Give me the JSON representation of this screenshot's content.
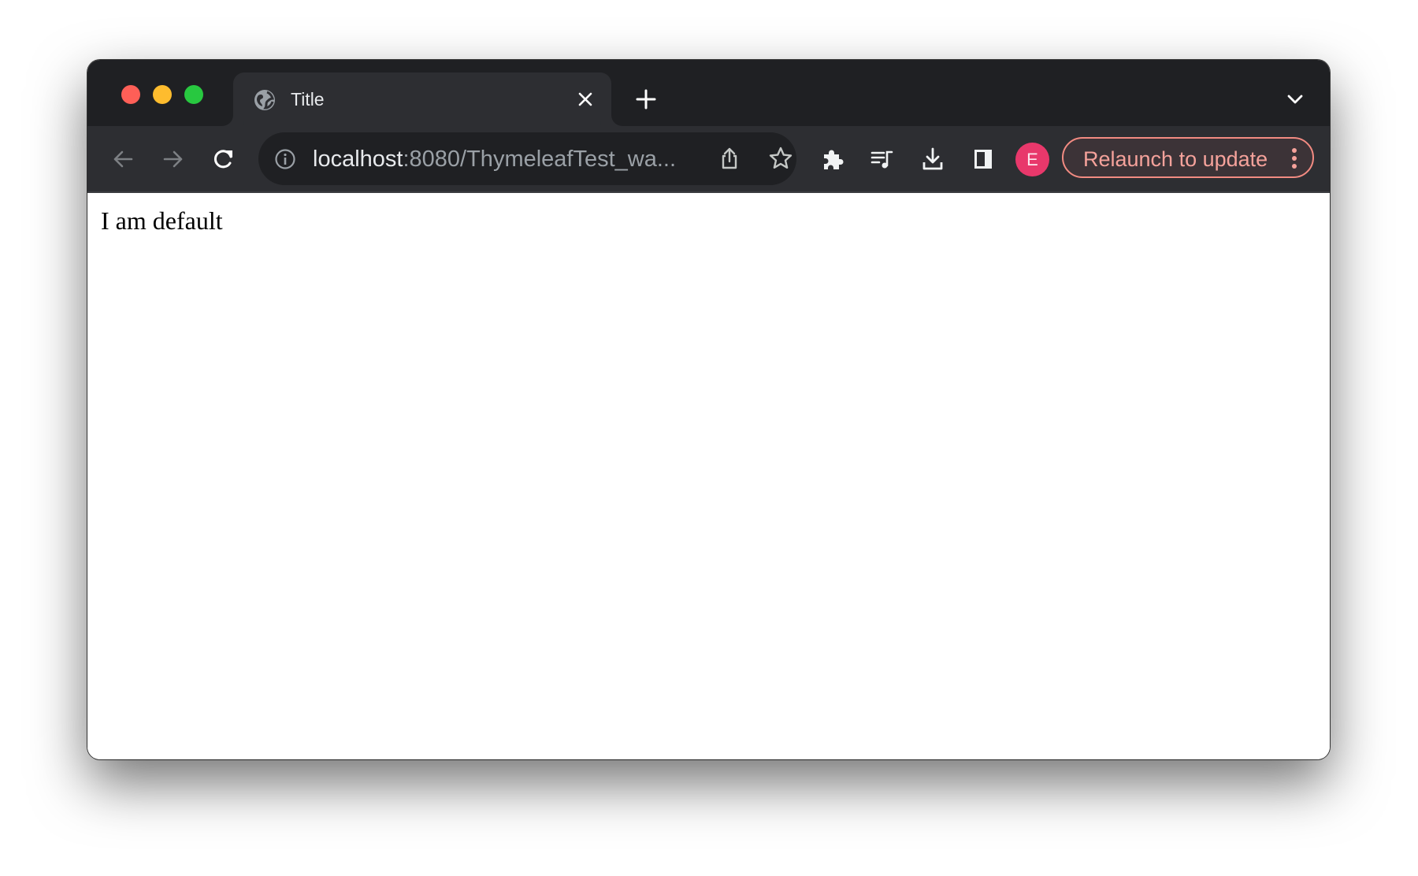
{
  "window": {
    "traffic_lights": [
      "close",
      "minimize",
      "zoom"
    ]
  },
  "tabs": [
    {
      "title": "Title",
      "favicon": "globe-icon",
      "active": true
    }
  ],
  "tab_strip": {
    "new_tab_icon": "plus-icon",
    "tab_search_icon": "chevron-down-icon"
  },
  "toolbar": {
    "back_icon": "arrow-left-icon",
    "forward_icon": "arrow-right-icon",
    "reload_icon": "reload-icon",
    "omnibox": {
      "host": "localhost",
      "path": ":8080/ThymeleafTest_wa...",
      "info_icon": "info-icon",
      "share_icon": "share-icon",
      "bookmark_icon": "star-icon"
    },
    "extensions_icon": "puzzle-icon",
    "media_icon": "media-queue-icon",
    "downloads_icon": "download-icon",
    "side_panel_icon": "side-panel-icon",
    "profile_initial": "E",
    "relaunch_label": "Relaunch to update",
    "menu_icon": "kebab-menu-icon"
  },
  "colors": {
    "titlebar": "#1f2023",
    "toolbar": "#2d2e32",
    "avatar": "#e8386b",
    "relaunch_accent": "#f28b82"
  },
  "page": {
    "body_text": "I am default"
  }
}
